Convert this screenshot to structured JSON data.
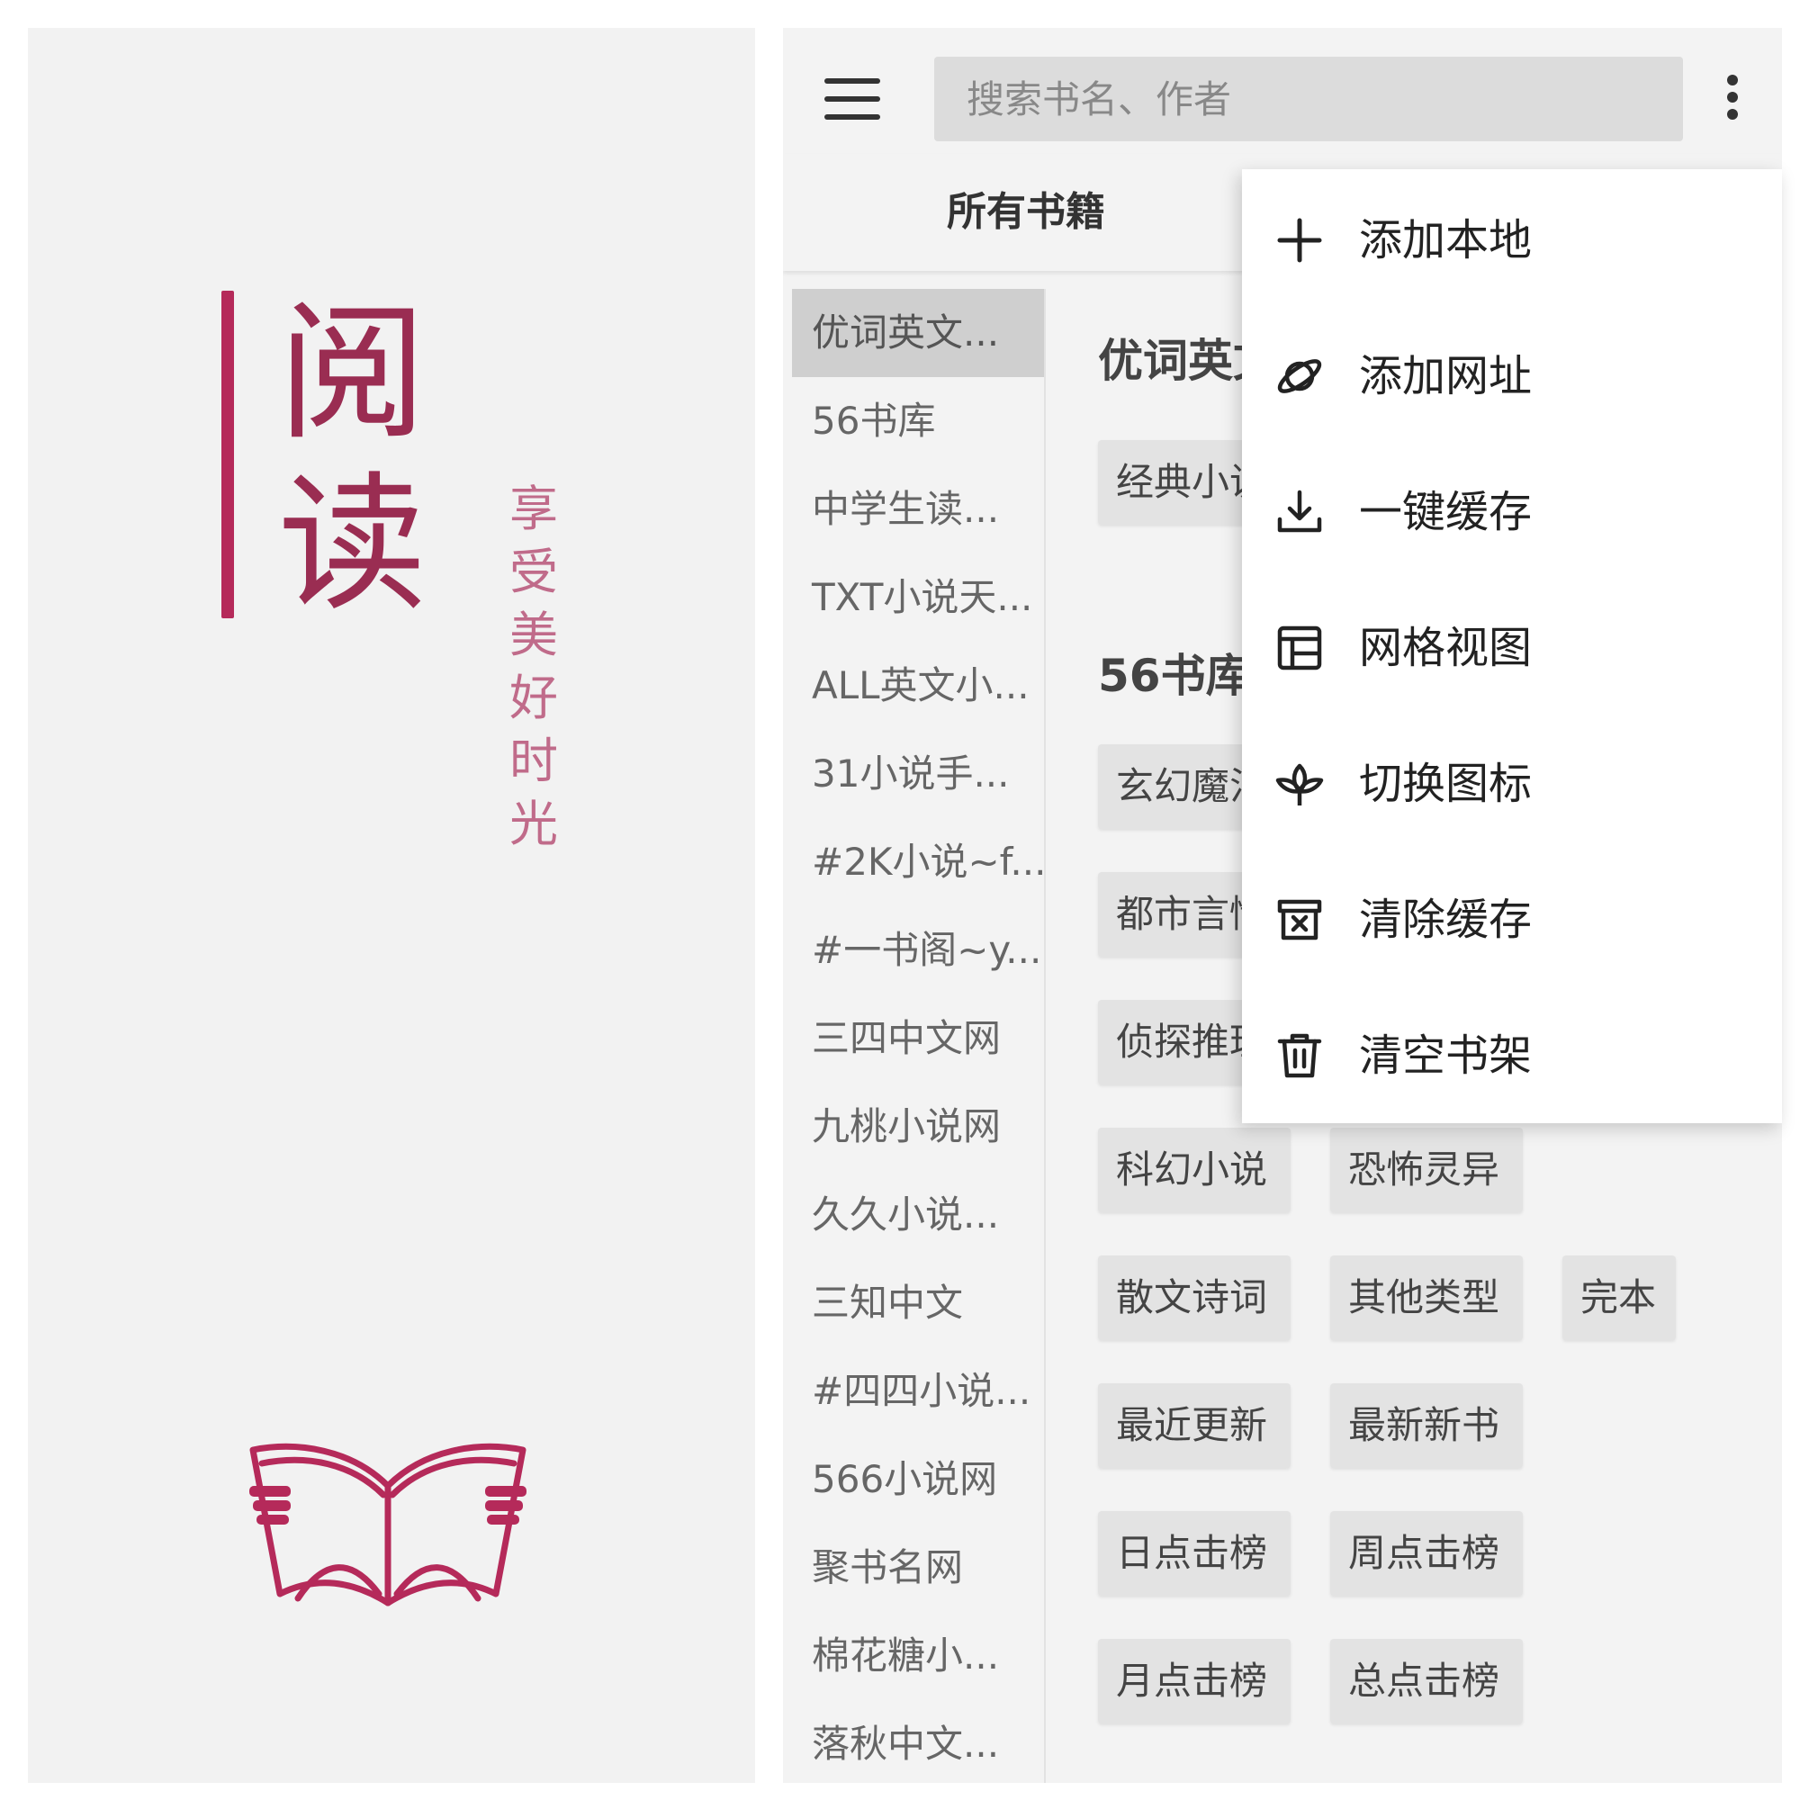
{
  "splash": {
    "title_chars": [
      "阅",
      "读"
    ],
    "tagline_chars": [
      "享",
      "受",
      "美",
      "好",
      "时",
      "光"
    ],
    "accent_color": "#b52a5a",
    "logo_icon": "open-book-hands-icon"
  },
  "toolbar": {
    "menu_icon": "hamburger-menu-icon",
    "search_placeholder": "搜索书名、作者",
    "more_icon": "more-vertical-icon"
  },
  "tabs": [
    {
      "label": "所有书籍"
    }
  ],
  "sources": [
    {
      "label": "优词英文...",
      "active": true
    },
    {
      "label": "56书库"
    },
    {
      "label": "中学生读..."
    },
    {
      "label": "TXT小说天..."
    },
    {
      "label": "ALL英文小..."
    },
    {
      "label": "31小说手..."
    },
    {
      "label": "#2K小说~f..."
    },
    {
      "label": "#一书阁~y..."
    },
    {
      "label": "三四中文网"
    },
    {
      "label": "九桃小说网"
    },
    {
      "label": "久久小说..."
    },
    {
      "label": "三知中文"
    },
    {
      "label": "#四四小说..."
    },
    {
      "label": "566小说网"
    },
    {
      "label": "聚书名网"
    },
    {
      "label": "棉花糖小..."
    },
    {
      "label": "落秋中文..."
    }
  ],
  "content": {
    "section1_title": "优词英文",
    "section1_chips": [
      "经典小说"
    ],
    "section2_title": "56书库",
    "section2_chips": [
      "玄幻魔法",
      "都市言情",
      "侦探推理",
      "科幻小说",
      "恐怖灵异",
      "散文诗词",
      "其他类型",
      "完本",
      "最近更新",
      "最新新书",
      "日点击榜",
      "周点击榜",
      "月点击榜",
      "总点击榜"
    ]
  },
  "popup_menu": [
    {
      "label": "添加本地",
      "icon": "plus-icon"
    },
    {
      "label": "添加网址",
      "icon": "planet-icon"
    },
    {
      "label": "一键缓存",
      "icon": "download-icon"
    },
    {
      "label": "网格视图",
      "icon": "grid-layout-icon"
    },
    {
      "label": "切换图标",
      "icon": "flower-icon"
    },
    {
      "label": "清除缓存",
      "icon": "clear-box-icon"
    },
    {
      "label": "清空书架",
      "icon": "trash-icon"
    }
  ]
}
